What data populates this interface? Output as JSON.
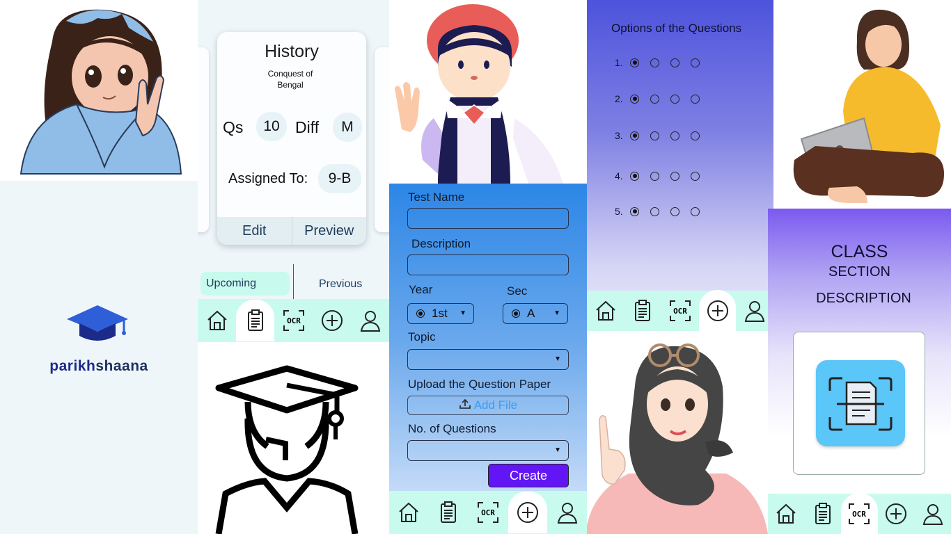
{
  "brand": {
    "part1": "parikh",
    "part2": "shaana"
  },
  "history_card": {
    "title": "History",
    "subtitle": "Conquest of Bengal",
    "qs_label": "Qs",
    "qs_value": "10",
    "diff_label": "Diff",
    "diff_value": "M",
    "assigned_label": "Assigned To:",
    "assigned_value": "9-B",
    "edit_label": "Edit",
    "preview_label": "Preview"
  },
  "tabs": {
    "upcoming": "Upcoming",
    "previous": "Previous"
  },
  "form": {
    "test_name_label": "Test Name",
    "description_label": "Description",
    "year_label": "Year",
    "year_value": "1st",
    "sec_label": "Sec",
    "sec_value": "A",
    "topic_label": "Topic",
    "upload_label": "Upload the Question Paper",
    "add_file_label": "Add File",
    "num_questions_label": "No. of Questions",
    "create_label": "Create"
  },
  "options": {
    "title": "Options of the Questions",
    "questions": [
      {
        "num": "1.",
        "selected": 0
      },
      {
        "num": "2.",
        "selected": 0
      },
      {
        "num": "3.",
        "selected": 0
      },
      {
        "num": "4.",
        "selected": 0
      },
      {
        "num": "5.",
        "selected": 0
      }
    ]
  },
  "class_panel": {
    "class_label": "CLASS",
    "section_label": "SECTION",
    "description_label": "DESCRIPTION"
  },
  "nav": {
    "ocr_label": "OCR",
    "icons": [
      "home-icon",
      "clipboard-icon",
      "ocr-scan-icon",
      "add-circle-icon",
      "user-icon"
    ]
  },
  "colors": {
    "nav_bg": "#c8fbee",
    "create_button": "#6316f5",
    "add_file_text": "#3b9cf0",
    "brand_dark": "#1c2a8a"
  }
}
